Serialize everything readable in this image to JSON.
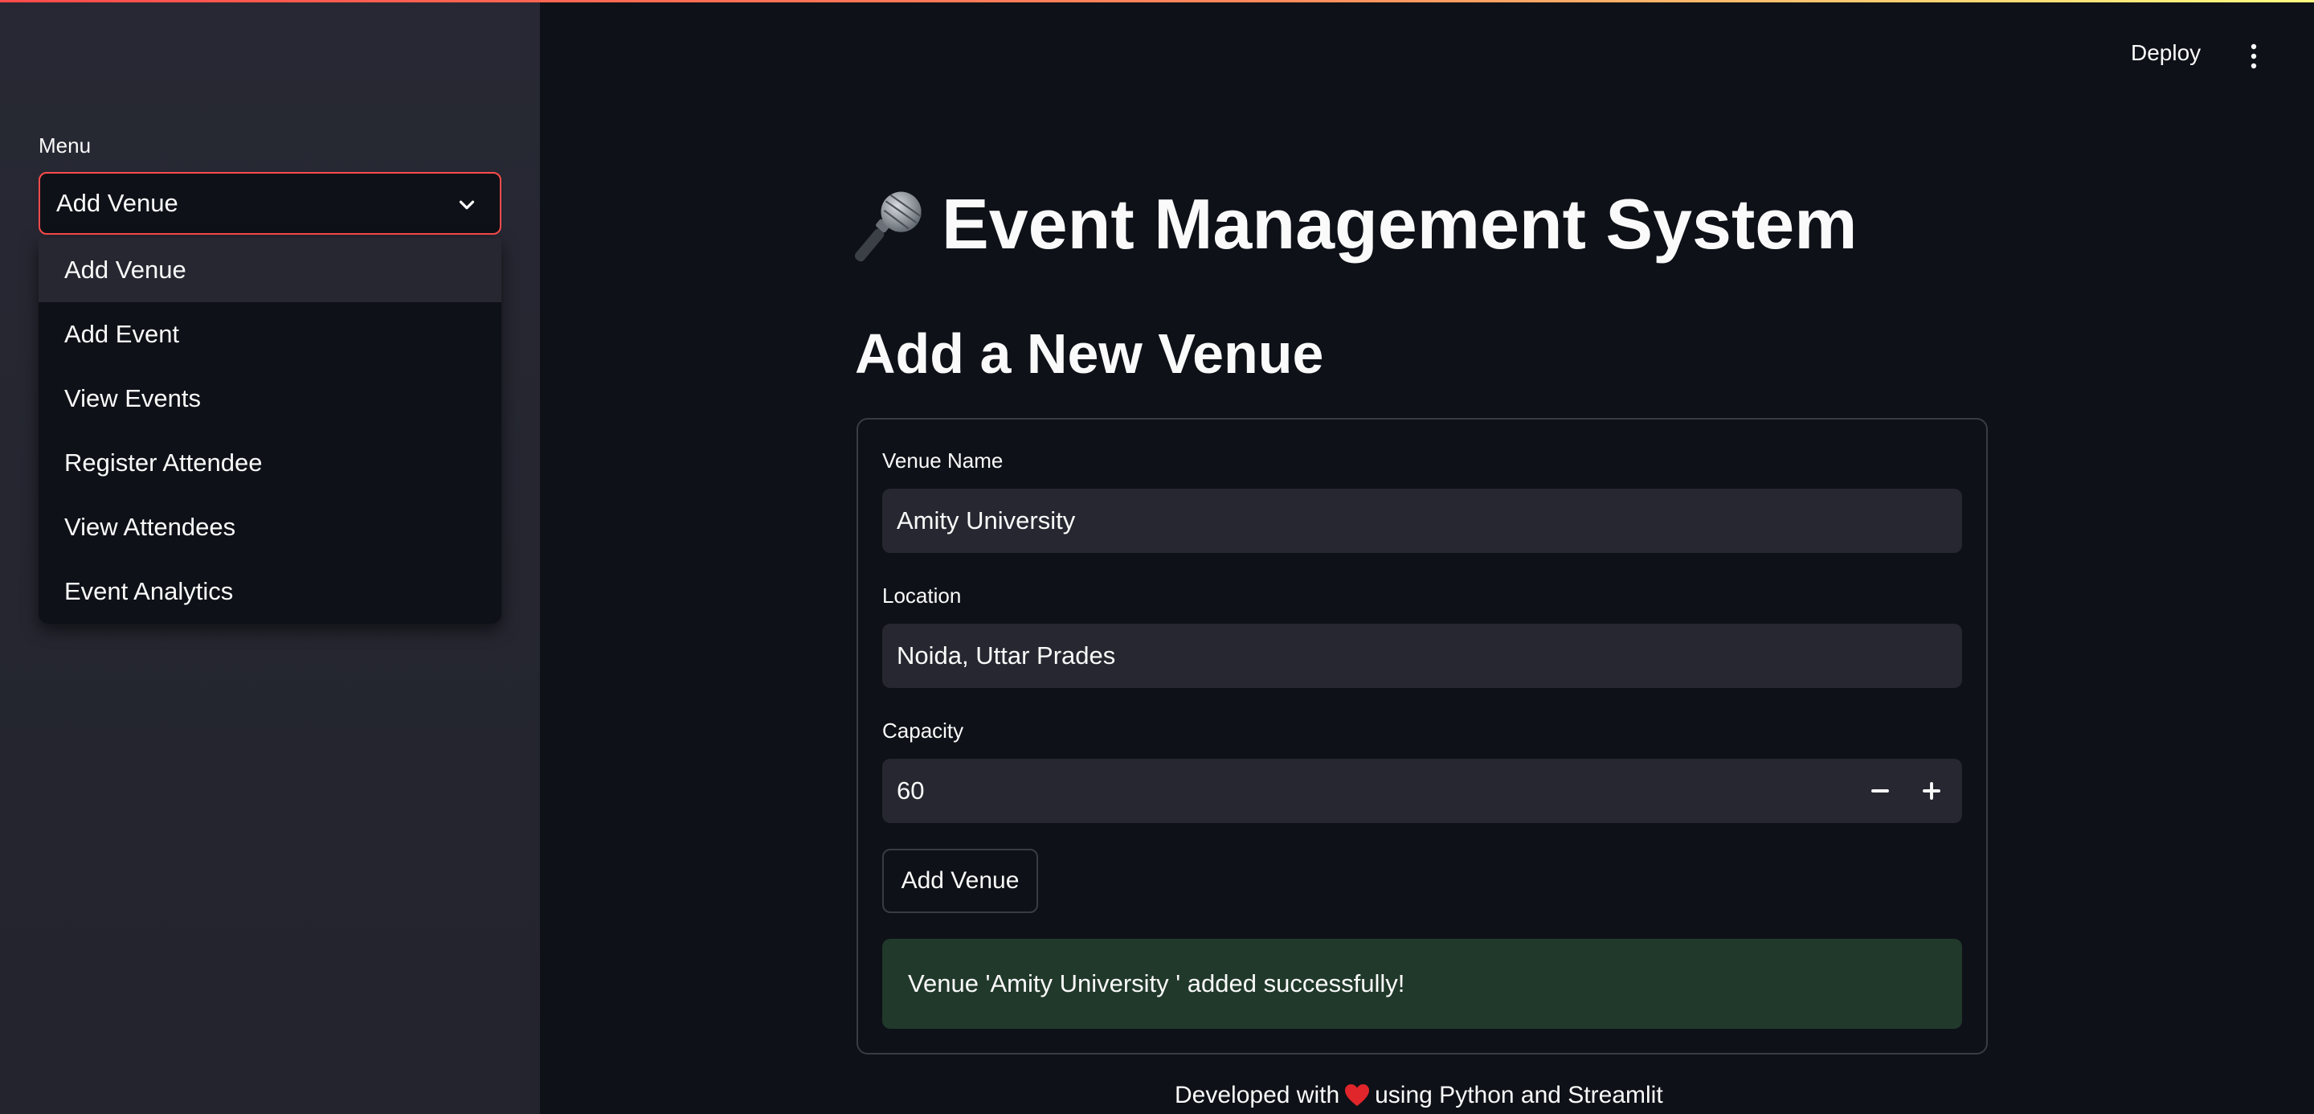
{
  "header": {
    "deploy_label": "Deploy",
    "menu_icon": "kebab-menu-icon"
  },
  "sidebar": {
    "menu_label": "Menu",
    "selected": "Add Venue",
    "options": [
      "Add Venue",
      "Add Event",
      "View Events",
      "Register Attendee",
      "View Attendees",
      "Event Analytics"
    ]
  },
  "main": {
    "title_icon": "microphone-icon",
    "title": "Event Management System",
    "subtitle": "Add a New Venue",
    "form": {
      "venue_name_label": "Venue Name",
      "venue_name_value": "Amity University",
      "location_label": "Location",
      "location_value": "Noida, Uttar Prades",
      "capacity_label": "Capacity",
      "capacity_value": "60",
      "submit_label": "Add Venue"
    },
    "success_message": "Venue 'Amity University ' added successfully!",
    "footer": {
      "text_before": "Developed with",
      "icon": "heart-icon",
      "text_after": "using Python and Streamlit"
    }
  },
  "colors": {
    "accent": "#ff4b4b",
    "background": "#0e1117",
    "sidebar": "#262730",
    "success_bg": "#21392b"
  }
}
